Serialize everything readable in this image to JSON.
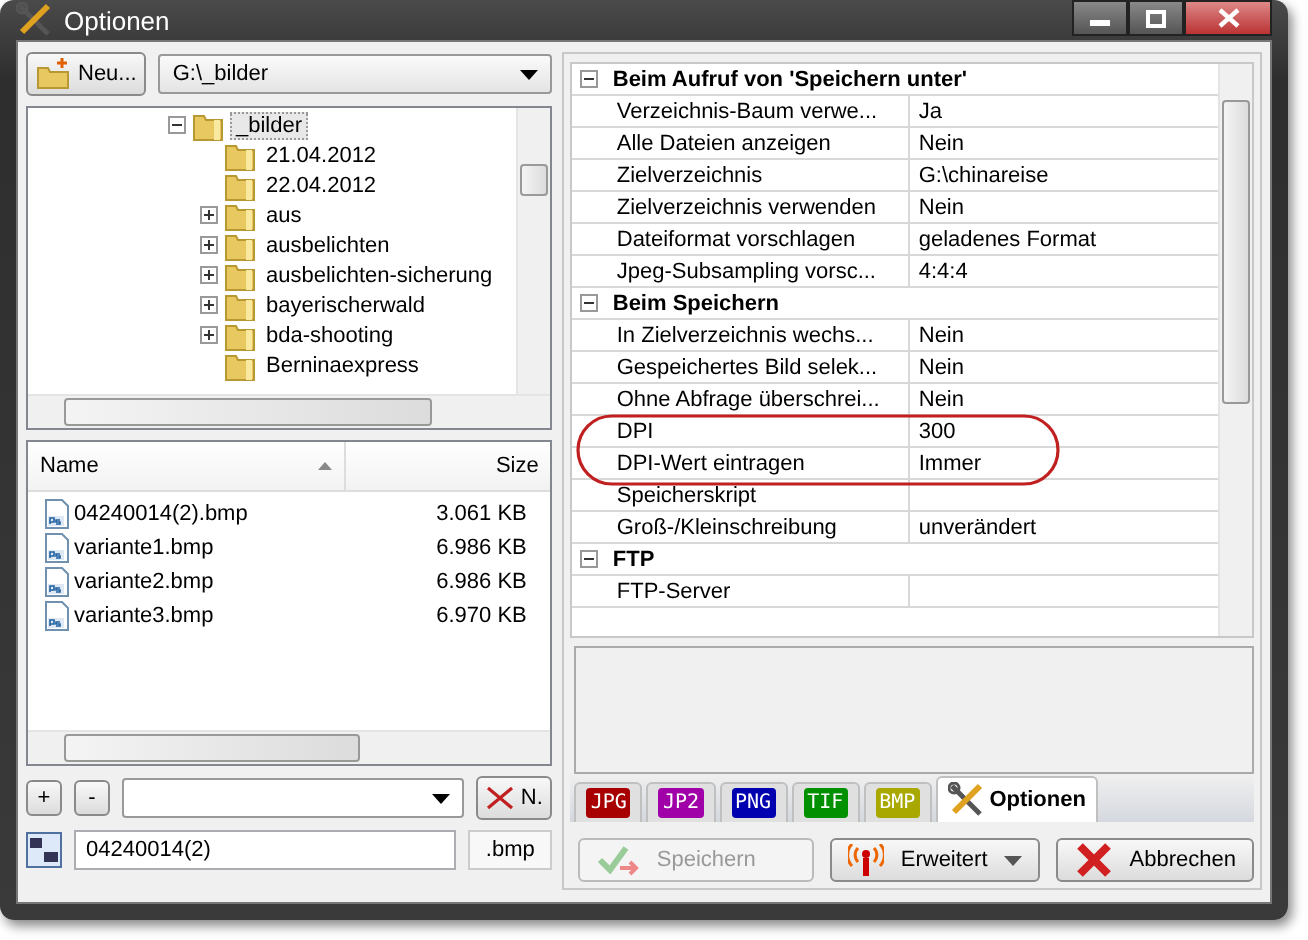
{
  "window": {
    "title": "Optionen"
  },
  "new_button": {
    "label": "Neu..."
  },
  "path_combo": {
    "value": "G:\\_bilder"
  },
  "tree": [
    {
      "label": "_bilder",
      "expanded": true,
      "selected": true,
      "children": [
        {
          "label": "21.04.2012",
          "selected": false
        },
        {
          "label": "22.04.2012",
          "selected": false
        },
        {
          "label": "aus",
          "expanded": false,
          "selected": false
        },
        {
          "label": "ausbelichten",
          "expanded": false,
          "selected": false
        },
        {
          "label": "ausbelichten-sicherung",
          "expanded": false,
          "selected": false
        },
        {
          "label": "bayerischerwald",
          "expanded": false,
          "selected": false
        },
        {
          "label": "bda-shooting",
          "expanded": false,
          "selected": false
        },
        {
          "label": "Berninaexpress",
          "selected": false
        }
      ]
    }
  ],
  "file_list": {
    "columns": [
      {
        "label": "Name",
        "sorted": true
      },
      {
        "label": "Size",
        "sorted": false
      }
    ],
    "rows": [
      {
        "name": "04240014(2).bmp",
        "size": "3.061 KB"
      },
      {
        "name": "variante1.bmp",
        "size": "6.986 KB"
      },
      {
        "name": "variante2.bmp",
        "size": "6.986 KB"
      },
      {
        "name": "variante3.bmp",
        "size": "6.970 KB"
      }
    ]
  },
  "add_button": {
    "label": "+"
  },
  "remove_button": {
    "label": "-"
  },
  "delete_button": {
    "label": "N."
  },
  "name_field": {
    "value": "04240014(2)",
    "extension": ".bmp"
  },
  "property_grid": [
    {
      "title": "Beim Aufruf von 'Speichern unter'",
      "expanded": true,
      "rows": [
        {
          "name": "Verzeichnis-Baum verwe...",
          "value": "Ja"
        },
        {
          "name": "Alle Dateien anzeigen",
          "value": "Nein"
        },
        {
          "name": "Zielverzeichnis",
          "value": "G:\\chinareise"
        },
        {
          "name": "Zielverzeichnis verwenden",
          "value": "Nein"
        },
        {
          "name": "Dateiformat vorschlagen",
          "value": "geladenes Format"
        },
        {
          "name": "Jpeg-Subsampling vorsc...",
          "value": "4:4:4"
        }
      ]
    },
    {
      "title": "Beim Speichern",
      "expanded": true,
      "rows": [
        {
          "name": "In Zielverzeichnis wechs...",
          "value": "Nein"
        },
        {
          "name": "Gespeichertes Bild selek...",
          "value": "Nein"
        },
        {
          "name": "Ohne Abfrage überschrei...",
          "value": "Nein"
        },
        {
          "name": "DPI",
          "value": "300"
        },
        {
          "name": "DPI-Wert eintragen",
          "value": "Immer"
        },
        {
          "name": "Speicherskript"
        },
        {
          "name": "Groß-/Kleinschreibung",
          "value": "unverändert"
        }
      ]
    },
    {
      "title": "FTP",
      "expanded": true,
      "rows": [
        {
          "name": "FTP-Server"
        }
      ]
    }
  ],
  "tabs": [
    {
      "label": "JPG",
      "kind": "format",
      "color": "#a80000",
      "selected": false
    },
    {
      "label": "JP2",
      "kind": "format",
      "color": "#a000a8",
      "selected": false
    },
    {
      "label": "PNG",
      "kind": "format",
      "color": "#0000b0",
      "selected": false
    },
    {
      "label": "TIF",
      "kind": "format",
      "color": "#009000",
      "selected": false
    },
    {
      "label": "BMP",
      "kind": "format",
      "color": "#a8a800",
      "selected": false
    },
    {
      "label": "Optionen",
      "kind": "options",
      "selected": true
    }
  ],
  "buttons": [
    {
      "label": "Speichern",
      "kind": "save",
      "disabled": true
    },
    {
      "label": "Erweitert",
      "kind": "advanced",
      "disabled": false
    },
    {
      "label": "Abbrechen",
      "kind": "cancel",
      "disabled": false
    }
  ]
}
